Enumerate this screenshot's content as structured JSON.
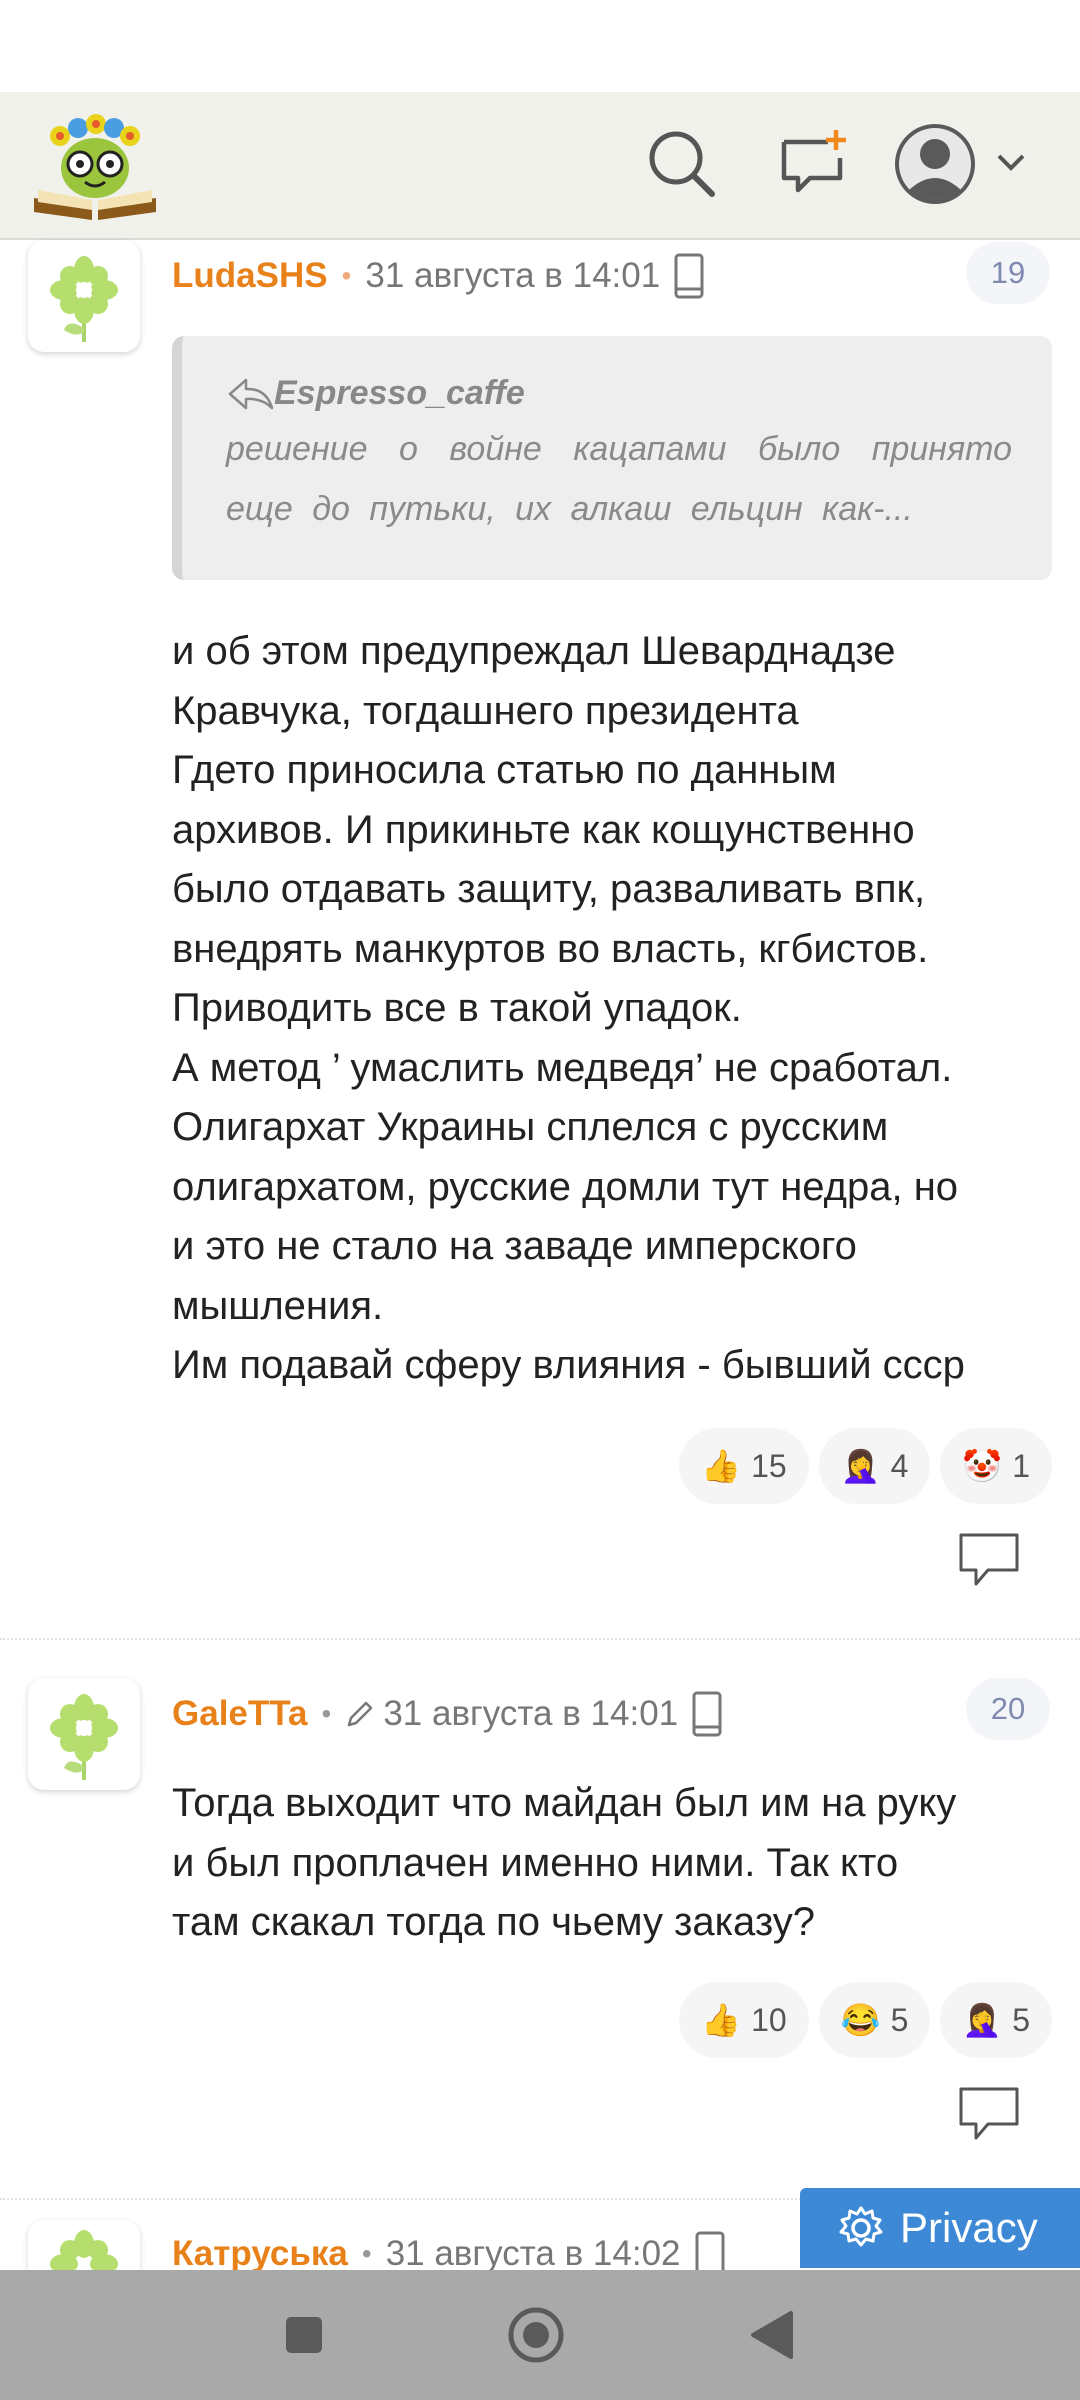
{
  "header": {
    "logo_label": "site-logo",
    "search_icon": "search-icon",
    "compose_icon": "new-message-icon",
    "avatar_icon": "user-avatar-icon",
    "menu_icon": "chevron-down-icon"
  },
  "colors": {
    "author": "#e8811a",
    "accent_blue": "#3d89d6",
    "appbar_bg": "#f1f1ec",
    "navbar_bg": "#a9a9a9"
  },
  "comments": [
    {
      "author": "LudaSHS",
      "separator": "•",
      "date": "31 августа в 14:01",
      "number": "19",
      "quote": {
        "author": "Espresso_caffe",
        "text": "решение о войне кацапами было принято еще до путьки, их алкаш ельцин как-..."
      },
      "body": "и об этом предупреждал Шеварднадзе\nКравчука, тогдашнего президента\nГдето приносила статью по данным\nархивов. И прикиньте как кощунственно\nбыло отдавать защиту, разваливать впк,\nвнедрять манкуртов во власть, кгбистов.\nПриводить все в такой упадок.\nА метод ’ умаслить медведя’ не сработал.\nОлигархат Украины сплелся с русским\nолигархатом, русские домли тут недра, но\nи это не стало на заваде имперского\nмышления.\nИм подавай сферу влияния - бывший ссср",
      "reactions": [
        {
          "emoji": "👍",
          "count": "15"
        },
        {
          "emoji": "🤦‍♀️",
          "count": "4"
        },
        {
          "emoji": "🤡",
          "count": "1"
        }
      ]
    },
    {
      "author": "GaleTTa",
      "separator": "•",
      "edited_icon": "pencil-icon",
      "date": "31 августа в 14:01",
      "number": "20",
      "body": "Тогда выходит что майдан был им на руку\nи был проплачен именно ними. Так кто\nтам скакал тогда по чьему заказу?",
      "reactions": [
        {
          "emoji": "👍",
          "count": "10"
        },
        {
          "emoji": "😂",
          "count": "5"
        },
        {
          "emoji": "🤦‍♀️",
          "count": "5"
        }
      ]
    },
    {
      "author": "Катруська",
      "separator": "•",
      "date": "31 августа в 14:02"
    }
  ],
  "privacy_button": "Privacy",
  "navbar": {
    "recents": "square-icon",
    "home": "circle-icon",
    "back": "back-triangle-icon"
  }
}
